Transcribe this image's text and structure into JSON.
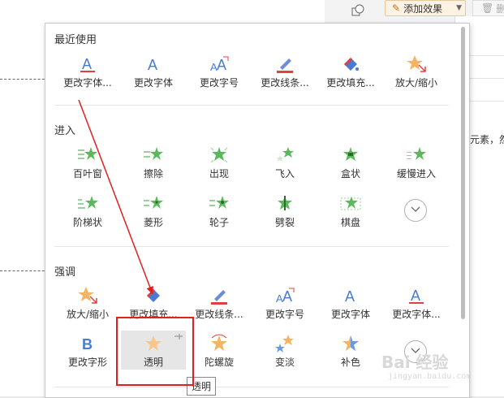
{
  "toolbar": {
    "add_effect_label": "添加效果",
    "delete_label": "删"
  },
  "background": {
    "right_text": "个元素，然"
  },
  "sections": {
    "recent": {
      "title": "最近使用",
      "items": [
        {
          "label": "更改字体...",
          "icon": "letter-a-underline-icon"
        },
        {
          "label": "更改字体",
          "icon": "letter-a-icon"
        },
        {
          "label": "更改字号",
          "icon": "letter-a-grow-icon"
        },
        {
          "label": "更改线条...",
          "icon": "line-color-pen-icon"
        },
        {
          "label": "更改填充...",
          "icon": "fill-bucket-icon"
        },
        {
          "label": "放大/缩小",
          "icon": "star-zoom-icon"
        }
      ]
    },
    "entrance": {
      "title": "进入",
      "items": [
        {
          "label": "百叶窗",
          "icon": "blinds-star-icon"
        },
        {
          "label": "擦除",
          "icon": "wipe-star-icon"
        },
        {
          "label": "出现",
          "icon": "appear-star-icon"
        },
        {
          "label": "飞入",
          "icon": "fly-in-star-icon"
        },
        {
          "label": "盒状",
          "icon": "box-star-icon"
        },
        {
          "label": "缓慢进入",
          "icon": "crawl-in-star-icon"
        },
        {
          "label": "阶梯状",
          "icon": "stairs-star-icon"
        },
        {
          "label": "菱形",
          "icon": "diamond-star-icon"
        },
        {
          "label": "轮子",
          "icon": "wheel-star-icon"
        },
        {
          "label": "劈裂",
          "icon": "split-star-icon"
        },
        {
          "label": "棋盘",
          "icon": "checkerboard-star-icon"
        }
      ]
    },
    "emphasis": {
      "title": "强调",
      "items": [
        {
          "label": "放大/缩小",
          "icon": "star-zoom-icon"
        },
        {
          "label": "更改填充...",
          "icon": "fill-bucket-icon"
        },
        {
          "label": "更改线条...",
          "icon": "line-color-pen-icon"
        },
        {
          "label": "更改字号",
          "icon": "letter-a-grow-icon"
        },
        {
          "label": "更改字体",
          "icon": "letter-a-icon"
        },
        {
          "label": "更改字体...",
          "icon": "letter-a-underline-icon"
        },
        {
          "label": "更改字形",
          "icon": "letter-b-icon"
        },
        {
          "label": "透明",
          "icon": "transparency-star-icon"
        },
        {
          "label": "陀螺旋",
          "icon": "spin-star-icon"
        },
        {
          "label": "变淡",
          "icon": "fade-stars-icon"
        },
        {
          "label": "补色",
          "icon": "complement-star-icon"
        }
      ]
    }
  },
  "tooltip": "透明",
  "watermark": {
    "text": "Bai 经验",
    "sub": "jingyan.baidu.com"
  },
  "colors": {
    "accent_red": "#e02020",
    "star_orange": "#f5b461",
    "star_green": "#5cb85c",
    "letter_blue": "#4a7bd0"
  }
}
